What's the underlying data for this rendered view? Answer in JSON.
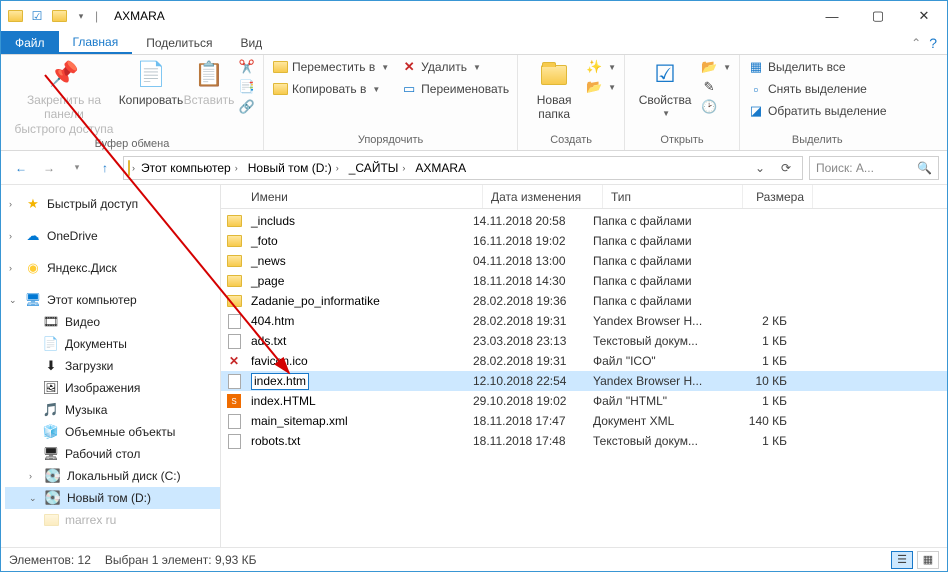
{
  "window_title": "AXMARA",
  "tabs": {
    "file": "Файл",
    "home": "Главная",
    "share": "Поделиться",
    "view": "Вид"
  },
  "ribbon": {
    "pin": "Закрепить на панели\nбыстрого доступа",
    "copy": "Копировать",
    "paste": "Вставить",
    "clip_tools": {
      "cut": "",
      "copy_path": "",
      "paste_shortcut": ""
    },
    "clipboard_label": "Буфер обмена",
    "move_to": "Переместить в",
    "copy_to": "Копировать в",
    "delete": "Удалить",
    "rename": "Переименовать",
    "organize_label": "Упорядочить",
    "new_folder": "Новая\nпапка",
    "new_label": "Создать",
    "properties": "Свойства",
    "open_label": "Открыть",
    "select_all": "Выделить все",
    "deselect": "Снять выделение",
    "invert": "Обратить выделение",
    "select_label": "Выделить"
  },
  "breadcrumbs": [
    "Этот компьютер",
    "Новый том (D:)",
    "_САЙТЫ",
    "AXMARA"
  ],
  "search_placeholder": "Поиск: A...",
  "columns": {
    "name": "Имени",
    "date": "Дата изменения",
    "type": "Тип",
    "size": "Размера"
  },
  "nav": {
    "quick": "Быстрый доступ",
    "onedrive": "OneDrive",
    "yandex": "Яндекс.Диск",
    "thispc": "Этот компьютер",
    "video": "Видео",
    "documents": "Документы",
    "downloads": "Загрузки",
    "pictures": "Изображения",
    "music": "Музыка",
    "objects3d": "Объемные объекты",
    "desktop": "Рабочий стол",
    "local_c": "Локальный диск (C:)",
    "local_d": "Новый том (D:)",
    "extra": "marrex ru"
  },
  "files": [
    {
      "icon": "folder",
      "name": "_includs",
      "date": "14.11.2018 20:58",
      "type": "Папка с файлами",
      "size": ""
    },
    {
      "icon": "folder",
      "name": "_foto",
      "date": "16.11.2018 19:02",
      "type": "Папка с файлами",
      "size": ""
    },
    {
      "icon": "folder",
      "name": "_news",
      "date": "04.11.2018 13:00",
      "type": "Папка с файлами",
      "size": ""
    },
    {
      "icon": "folder",
      "name": "_page",
      "date": "18.11.2018 14:30",
      "type": "Папка с файлами",
      "size": ""
    },
    {
      "icon": "folder",
      "name": "Zadanie_po_informatike",
      "date": "28.02.2018 19:36",
      "type": "Папка с файлами",
      "size": ""
    },
    {
      "icon": "html",
      "name": "404.htm",
      "date": "28.02.2018 19:31",
      "type": "Yandex Browser H...",
      "size": "2 КБ"
    },
    {
      "icon": "txt",
      "name": "ads.txt",
      "date": "23.03.2018 23:13",
      "type": "Текстовый докум...",
      "size": "1 КБ"
    },
    {
      "icon": "ico",
      "name": "favicon.ico",
      "date": "28.02.2018 19:31",
      "type": "Файл \"ICO\"",
      "size": "1 КБ"
    },
    {
      "icon": "html",
      "name": "index.htm",
      "date": "12.10.2018 22:54",
      "type": "Yandex Browser H...",
      "size": "10 КБ",
      "selected": true,
      "rename": true
    },
    {
      "icon": "html2",
      "name": "index.HTML",
      "date": "29.10.2018 19:02",
      "type": "Файл \"HTML\"",
      "size": "1 КБ"
    },
    {
      "icon": "xml",
      "name": "main_sitemap.xml",
      "date": "18.11.2018 17:47",
      "type": "Документ XML",
      "size": "140 КБ"
    },
    {
      "icon": "txt",
      "name": "robots.txt",
      "date": "18.11.2018 17:48",
      "type": "Текстовый докум...",
      "size": "1 КБ"
    }
  ],
  "status": {
    "count": "Элементов: 12",
    "selection": "Выбран 1 элемент: 9,93 КБ"
  }
}
